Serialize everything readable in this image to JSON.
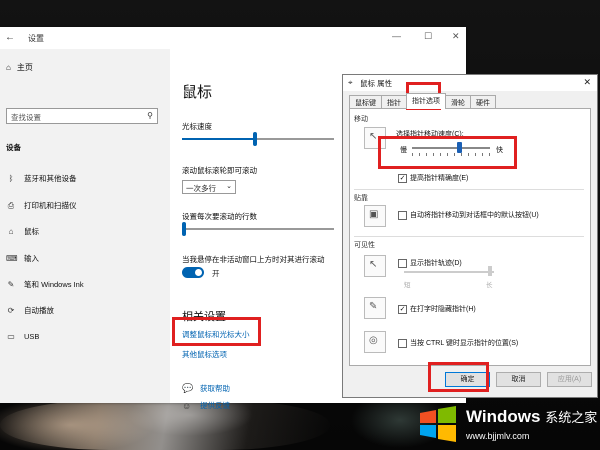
{
  "settings": {
    "window_title": "设置",
    "home_label": "主页",
    "search_placeholder": "查找设置",
    "section_header": "设备",
    "nav_items": [
      {
        "label": "蓝牙和其他设备",
        "icon": "bluetooth-icon"
      },
      {
        "label": "打印机和扫描仪",
        "icon": "printer-icon"
      },
      {
        "label": "鼠标",
        "icon": "mouse-icon"
      },
      {
        "label": "输入",
        "icon": "keyboard-icon"
      },
      {
        "label": "笔和 Windows Ink",
        "icon": "pen-icon"
      },
      {
        "label": "自动播放",
        "icon": "autoplay-icon"
      },
      {
        "label": "USB",
        "icon": "usb-icon"
      }
    ],
    "page_title": "鼠标",
    "cursor_speed_label": "光标速度",
    "cursor_speed_level": 0.48,
    "scroll_wheel_label": "滚动鼠标滚轮即可滚动",
    "scroll_wheel_value": "一次多行",
    "lines_label": "设置每次要滚动的行数",
    "lines_level": 0.0,
    "inactive_scroll_label": "当我悬停在非活动窗口上方时对其进行滚动",
    "inactive_scroll_state": "开",
    "related_header": "相关设置",
    "related_links": [
      "调整鼠标和光标大小",
      "其他鼠标选项"
    ],
    "help_items": [
      {
        "label": "获取帮助",
        "icon": "help-chat-icon"
      },
      {
        "label": "提供反馈",
        "icon": "feedback-icon"
      }
    ]
  },
  "dialog": {
    "title": "鼠标 属性",
    "tabs": [
      "鼠标键",
      "指针",
      "指针选项",
      "滑轮",
      "硬件"
    ],
    "active_tab": "指针选项",
    "motion_group": "移动",
    "speed_label": "选择指针移动速度(C):",
    "slow_label": "慢",
    "fast_label": "快",
    "speed_level": 0.6,
    "precision_label": "提高指针精确度(E)",
    "precision_checked": true,
    "snap_group": "贴靠",
    "snap_label": "自动将指针移动到对话框中的默认按钮(U)",
    "snap_checked": false,
    "visibility_group": "可见性",
    "trails_label": "显示指针轨迹(D)",
    "trails_checked": false,
    "short_label": "短",
    "long_label": "长",
    "hide_label": "在打字时隐藏指针(H)",
    "hide_checked": true,
    "ctrl_label": "当按 CTRL 键时显示指针的位置(S)",
    "ctrl_checked": false,
    "ok_label": "确定",
    "cancel_label": "取消",
    "apply_label": "应用(A)"
  },
  "watermark": {
    "brand": "Windows",
    "brand_suffix": "系统之家",
    "url": "www.bjjmlv.com"
  },
  "colors": {
    "accent": "#0063b1",
    "highlight": "#e02020"
  }
}
